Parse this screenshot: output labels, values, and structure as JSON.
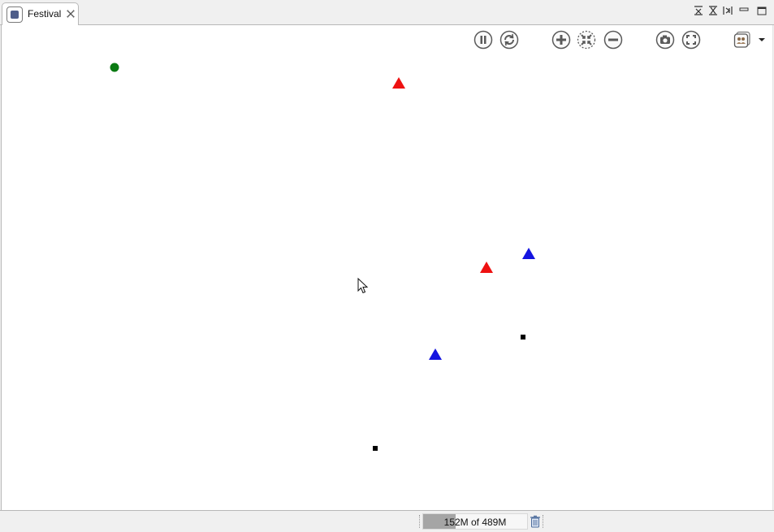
{
  "tab": {
    "label": "Festival",
    "icon": "display-view-icon",
    "close_icon": "close-tab-icon"
  },
  "window_controls": [
    {
      "name": "collapse-top-icon"
    },
    {
      "name": "collapse-bottom-icon"
    },
    {
      "name": "restore-side-icon"
    },
    {
      "name": "minimize-icon"
    },
    {
      "name": "maximize-icon"
    }
  ],
  "toolbar": {
    "pause_icon": "pause-icon",
    "sync_icon": "sync-icon",
    "zoom_in_icon": "zoom-in-icon",
    "zoom_fit_icon": "zoom-fit-icon",
    "zoom_out_icon": "zoom-out-icon",
    "snapshot_icon": "camera-icon",
    "fullscreen_icon": "fullscreen-icon",
    "layers_icon": "layers-icon",
    "dropdown_icon": "chevron-down-icon"
  },
  "display": {
    "agents": [
      {
        "shape": "circle",
        "color": "#0a7a12"
      },
      {
        "shape": "triangle",
        "color": "#ee1111"
      },
      {
        "shape": "triangle",
        "color": "#1414e0"
      },
      {
        "shape": "triangle",
        "color": "#ee1111"
      },
      {
        "shape": "square",
        "color": "#000000"
      },
      {
        "shape": "triangle",
        "color": "#1414e0"
      },
      {
        "shape": "square",
        "color": "#000000"
      }
    ]
  },
  "status": {
    "heap_label": "152M of 489M",
    "heap_used_fraction": 0.31,
    "gc_icon": "trash-icon"
  }
}
